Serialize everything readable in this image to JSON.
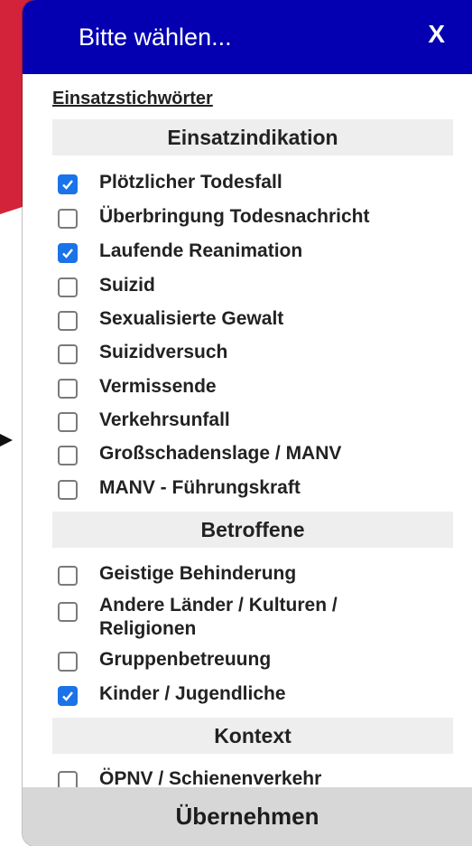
{
  "dialog": {
    "title": "Bitte wählen...",
    "close_label": "X",
    "list_title": "Einsatzstichwörter",
    "apply_label": "Übernehmen"
  },
  "sections": [
    {
      "title": "Einsatzindikation",
      "items": [
        {
          "label": "Plötzlicher Todesfall",
          "checked": true
        },
        {
          "label": "Überbringung Todesnachricht",
          "checked": false
        },
        {
          "label": "Laufende Reanimation",
          "checked": true
        },
        {
          "label": "Suizid",
          "checked": false
        },
        {
          "label": "Sexualisierte Gewalt",
          "checked": false
        },
        {
          "label": "Suizidversuch",
          "checked": false
        },
        {
          "label": "Vermissende",
          "checked": false
        },
        {
          "label": "Verkehrsunfall",
          "checked": false
        },
        {
          "label": "Großschadenslage / MANV",
          "checked": false
        },
        {
          "label": "MANV - Führungskraft",
          "checked": false
        }
      ]
    },
    {
      "title": "Betroffene",
      "items": [
        {
          "label": "Geistige Behinderung",
          "checked": false
        },
        {
          "label": "Andere Länder / Kulturen / Religionen",
          "checked": false
        },
        {
          "label": "Gruppenbetreuung",
          "checked": false
        },
        {
          "label": "Kinder / Jugendliche",
          "checked": true
        }
      ]
    },
    {
      "title": "Kontext",
      "items": [
        {
          "label": "ÖPNV / Schienenverkehr",
          "checked": false
        }
      ]
    }
  ],
  "colors": {
    "header": "#0400b2",
    "checkbox_checked": "#1a73e8",
    "section_bg": "#eeeeee",
    "apply_bg": "#d7d7d7"
  }
}
